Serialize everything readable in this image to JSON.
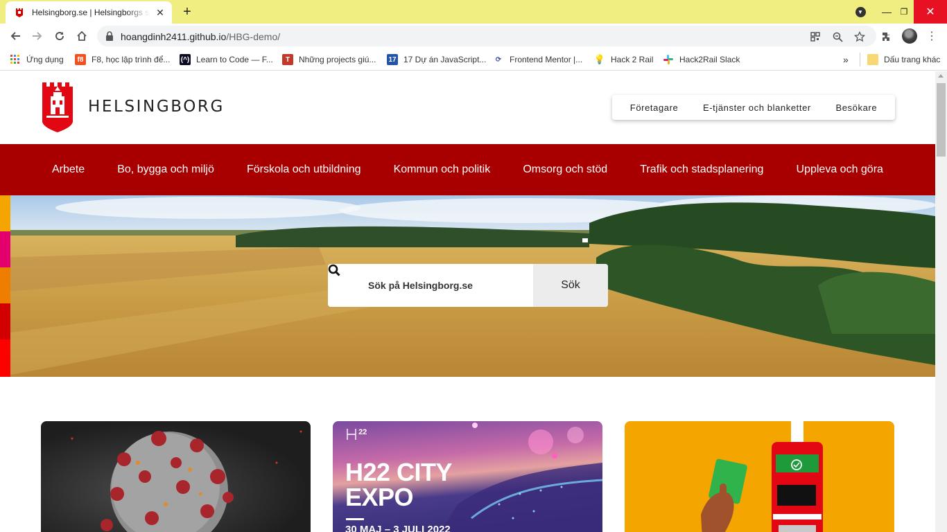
{
  "browser": {
    "tab_title": "Helsingborg.se | Helsingborgs stad",
    "url_host": "hoangdinh2411.github.io",
    "url_path": "/HBG-demo/",
    "bookmarks": [
      "Ứng dụng",
      "F8, học lập trình để...",
      "Learn to Code — F...",
      "Những projects giú...",
      "17 Dự án JavaScript...",
      "Frontend Mentor |...",
      "Hack 2 Rail",
      "Hack2Rail Slack"
    ],
    "other_bookmarks": "Dấu trang khác",
    "overflow": "»"
  },
  "site": {
    "logo_text": "HELSINGBORG",
    "utility_nav": [
      "Företagare",
      "E-tjänster och blanketter",
      "Besökare"
    ],
    "main_nav": [
      "Arbete",
      "Bo, bygga och miljö",
      "Förskola och utbildning",
      "Kommun och politik",
      "Omsorg och stöd",
      "Trafik och stadsplanering",
      "Uppleva och göra"
    ],
    "search": {
      "placeholder": "Sök på Helsingborg.se",
      "button": "Sök"
    },
    "cards": {
      "h22": {
        "logo": "22",
        "title": "H22 CITY EXPO",
        "date": "30 MAJ – 3 JULI 2022"
      }
    }
  },
  "colors": {
    "brand_red": "#a80000",
    "tab_strip": "#f1ee81",
    "strip": [
      "#f4a500",
      "#e3006d",
      "#ef7d00",
      "#d20000",
      "#ff0000"
    ]
  }
}
